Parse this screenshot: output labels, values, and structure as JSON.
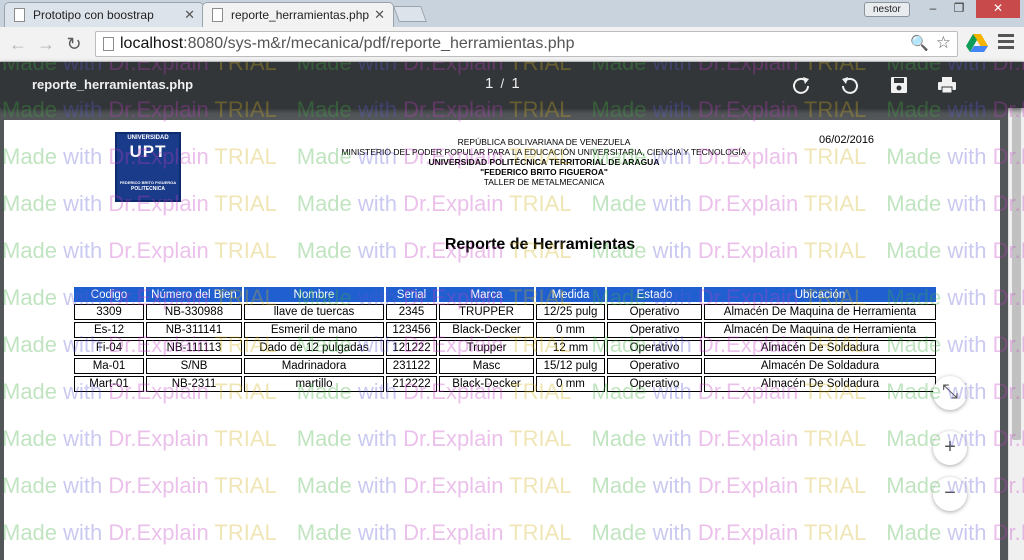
{
  "browser": {
    "tabs": [
      {
        "title": "Prototipo con boostrap",
        "active": false
      },
      {
        "title": "reporte_herramientas.php",
        "active": true
      }
    ],
    "profile_name": "nestor",
    "url_host": "localhost",
    "url_rest": ":8080/sys-m&r/mecanica/pdf/reporte_herramientas.php"
  },
  "pdf_viewer": {
    "file_name": "reporte_herramientas.php",
    "current_page": "1",
    "page_separator": "/",
    "total_pages": "1"
  },
  "report": {
    "logo": {
      "line1": "UNIVERSIDAD",
      "line2": "UPT",
      "line3": "FEDERICO BRITO FIGUEROA",
      "line4": "POLITECNICA"
    },
    "header_lines": [
      "REPÚBLICA BOLIVARIANA DE VENEZUELA",
      "MINISTERIO DEL PODER POPULAR PARA LA EDUCACIÓN UNIVERSITARIA, CIENCIA Y TECNOLOGÍA",
      "UNIVERSIDAD POLITÉCNICA TERRITORIAL DE ARAGUA",
      "\"FEDERICO BRITO FIGUEROA\"",
      "TALLER DE METALMECANICA"
    ],
    "date": "06/02/2016",
    "title": "Reporte de Herramientas",
    "columns": [
      "Codigo",
      "Número del Bien",
      "Nombre",
      "Serial",
      "Marca",
      "Medida",
      "Estado",
      "Ubicación"
    ],
    "rows": [
      [
        "3309",
        "NB-330988",
        "llave de tuercas",
        "2345",
        "TRUPPER",
        "12/25 pulg",
        "Operativo",
        "Almacén De Maquina de Herramienta"
      ],
      [
        "Es-12",
        "NB-311141",
        "Esmeril de mano",
        "123456",
        "Black-Decker",
        "0 mm",
        "Operativo",
        "Almacén De Maquina de Herramienta"
      ],
      [
        "Fi-04",
        "NB-111113",
        "Dado de 12 pulgadas",
        "121222",
        "Trupper",
        "12 mm",
        "Operativo",
        "Almacén De Soldadura"
      ],
      [
        "Ma-01",
        "S/NB",
        "Madrinadora",
        "231122",
        "Masc",
        "15/12 pulg",
        "Operativo",
        "Almacén De Soldadura"
      ],
      [
        "Mart-01",
        "NB-2311",
        "martillo",
        "212222",
        "Black-Decker",
        "0 mm",
        "Operativo",
        "Almacén De Soldadura"
      ]
    ]
  },
  "watermark": {
    "made": "Made",
    "with": " with ",
    "brand": "Dr.Explain",
    "trial": " TRIAL"
  },
  "colors": {
    "table_header": "#1f5fd0",
    "pdf_toolbar": "#323639",
    "viewer_bg": "#525659"
  }
}
